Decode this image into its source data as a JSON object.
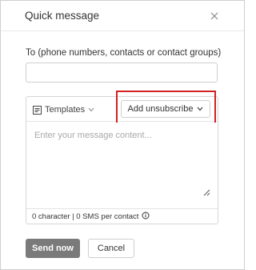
{
  "dialog": {
    "title": "Quick message",
    "close_icon": "close-icon"
  },
  "recipient": {
    "label": "To (phone numbers, contacts or contact groups)",
    "value": "",
    "placeholder": ""
  },
  "composer": {
    "templates_label": "Templates",
    "templates_icon": "template-icon",
    "unsubscribe_label": "Add unsubscribe",
    "message_placeholder": "Enter your message content...",
    "message_value": "",
    "counter_text": "0 character | 0 SMS per contact",
    "info_icon": "info-icon"
  },
  "actions": {
    "send_label": "Send now",
    "cancel_label": "Cancel"
  },
  "colors": {
    "highlight": "#d32121",
    "send_button": "#7a7a7a"
  }
}
